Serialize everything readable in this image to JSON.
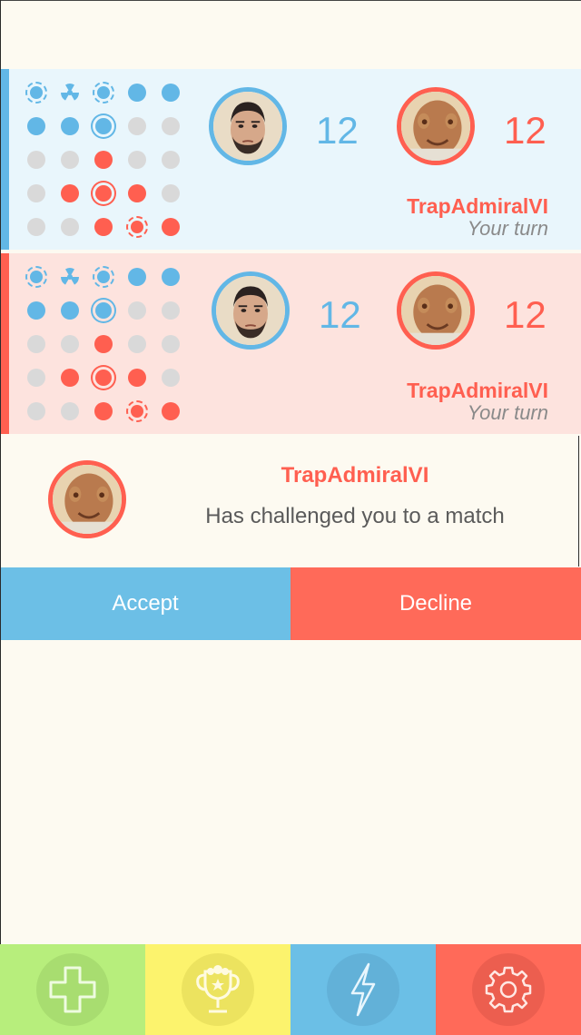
{
  "colors": {
    "blue": "#62b7e6",
    "red": "#ff5f50",
    "background": "#fdfaf1",
    "green_tab": "#b7ee7c",
    "yellow_tab": "#fcf36d"
  },
  "matches": [
    {
      "theme": "blue",
      "player_avatar": "bearded-man-avatar",
      "player_score": "12",
      "opponent_avatar": "admiral-avatar",
      "opponent_score": "12",
      "opponent_name": "TrapAdmiralVI",
      "status": "Your turn"
    },
    {
      "theme": "red",
      "player_avatar": "bearded-man-avatar",
      "player_score": "12",
      "opponent_avatar": "admiral-avatar",
      "opponent_score": "12",
      "opponent_name": "TrapAdmiralVI",
      "status": "Your turn"
    }
  ],
  "board_pattern": [
    [
      "target-blue",
      "radiation",
      "target-blue",
      "blue",
      "blue"
    ],
    [
      "blue",
      "blue",
      "ring-blue",
      "gray",
      "gray"
    ],
    [
      "gray",
      "gray",
      "red",
      "gray",
      "gray"
    ],
    [
      "gray",
      "red",
      "ring-red",
      "red",
      "gray"
    ],
    [
      "gray",
      "gray",
      "red",
      "target-red",
      "red"
    ]
  ],
  "challenge": {
    "avatar": "admiral-avatar",
    "name": "TrapAdmiralVI",
    "message": "Has challenged you to a match",
    "accept_label": "Accept",
    "decline_label": "Decline"
  },
  "tabbar": [
    {
      "name": "new-game",
      "icon": "plus-icon"
    },
    {
      "name": "leaderboard",
      "icon": "trophy-icon"
    },
    {
      "name": "powerups",
      "icon": "lightning-icon"
    },
    {
      "name": "settings",
      "icon": "gear-icon"
    }
  ]
}
